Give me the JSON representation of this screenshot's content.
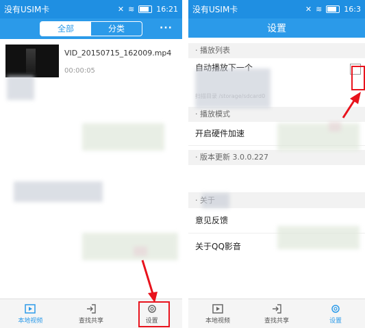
{
  "left": {
    "status": {
      "carrier": "没有USIM卡",
      "time": "16:21"
    },
    "header": {
      "tab_all": "全部",
      "tab_category": "分类",
      "more": "···"
    },
    "video": {
      "name": "VID_20150715_162009.mp4",
      "duration": "00:00:05"
    },
    "tabbar": {
      "local": "本地视频",
      "share": "查找共享",
      "settings": "设置"
    }
  },
  "right": {
    "status": {
      "carrier": "没有USIM卡",
      "time": "16:3"
    },
    "header": {
      "title": "设置"
    },
    "sections": {
      "playlist": "播放列表",
      "playmode": "播放模式",
      "version": "版本更新 3.0.0.227",
      "about": "关于"
    },
    "items": {
      "autoplay": "自动播放下一个",
      "scan_dir": "扫描目录 /storage/sdcard0",
      "hw_accel": "开启硬件加速",
      "feedback": "意见反馈",
      "about_app": "关于QQ影音"
    },
    "tabbar": {
      "local": "本地视频",
      "share": "查找共享",
      "settings": "设置"
    }
  },
  "colors": {
    "accent": "#2b9ae9",
    "highlight": "#e8121c"
  }
}
